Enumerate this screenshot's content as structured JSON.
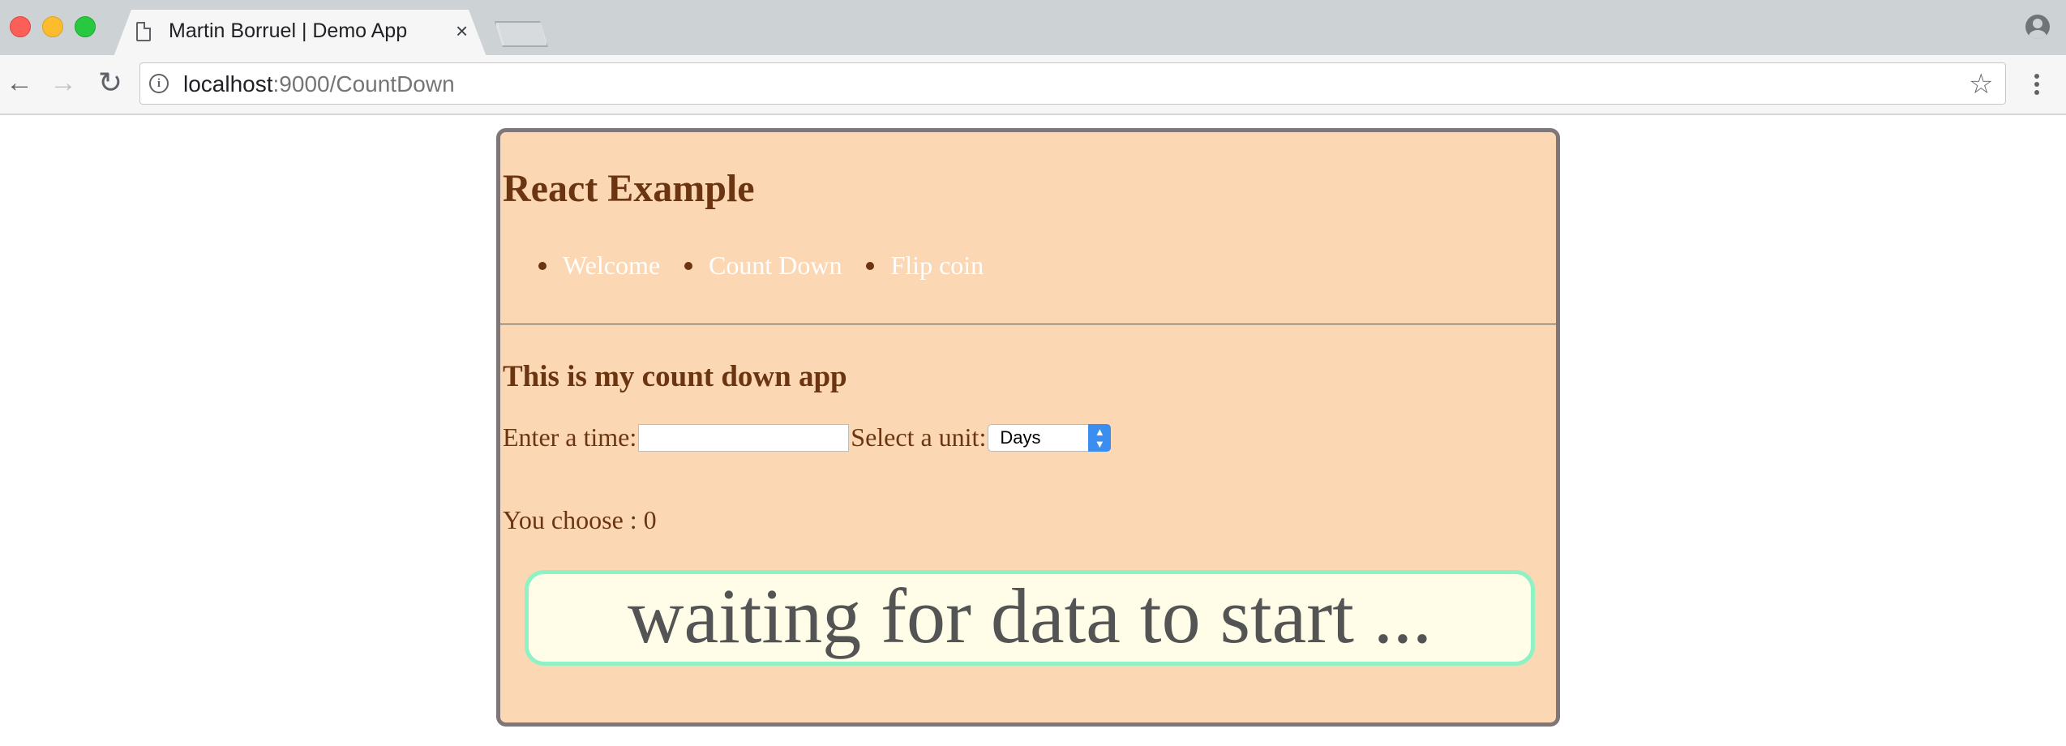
{
  "browser": {
    "tab_title": "Martin Borruel | Demo App",
    "tab_close": "×",
    "url_host": "localhost",
    "url_path": ":9000/CountDown",
    "icons": {
      "back": "arrow-left-icon",
      "forward": "arrow-right-icon",
      "reload": "reload-icon",
      "info": "info-icon",
      "bookmark": "star-icon",
      "menu": "kebab-menu-icon",
      "profile": "profile-icon"
    }
  },
  "app": {
    "title": "React Example",
    "nav": [
      {
        "label": "Welcome"
      },
      {
        "label": "Count Down"
      },
      {
        "label": "Flip coin"
      }
    ],
    "subtitle": "This is my count down app",
    "time_label": "Enter a time:",
    "time_value": "",
    "unit_label": "Select a unit:",
    "unit_selected": "Days",
    "choose_text": "You choose : 0",
    "status_text": "waiting for data to start ...",
    "colors": {
      "panel_background": "#fcd7b4",
      "text_brown": "#6a3510",
      "status_border": "#8ff2c4",
      "status_background": "#fffde8"
    }
  }
}
